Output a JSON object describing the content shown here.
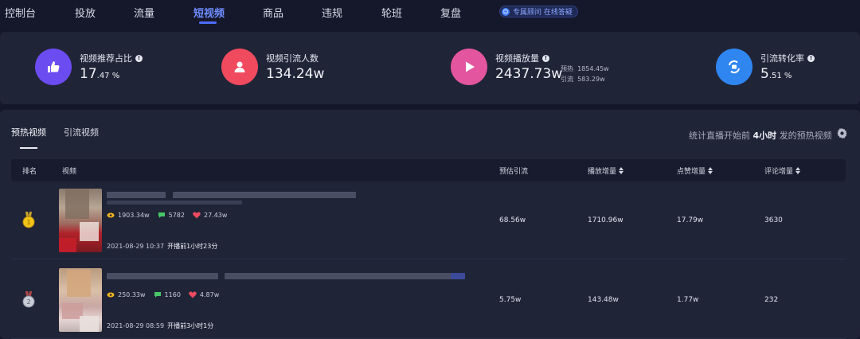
{
  "nav": {
    "items": [
      "控制台",
      "投放",
      "流量",
      "短视频",
      "商品",
      "违规",
      "轮班",
      "复盘"
    ],
    "active_index": 3,
    "consult_label": "专属顾问 在线答疑"
  },
  "stats": [
    {
      "label": "视频推荐占比",
      "value_main": "17",
      "value_small": ".47 %",
      "icon": "thumbs-up-icon",
      "color": "#6b4cf0"
    },
    {
      "label": "视频引流人数",
      "value_main": "134.24w",
      "value_small": "",
      "icon": "user-icon",
      "color": "#f04a5e"
    },
    {
      "label": "视频播放量",
      "value_main": "2437.73w",
      "value_small": "",
      "icon": "play-icon",
      "color": "#e3559f",
      "sub": [
        {
          "label": "预热",
          "value": "1854.45w"
        },
        {
          "label": "引流",
          "value": "583.29w"
        }
      ]
    },
    {
      "label": "引流转化率",
      "value_main": "5",
      "value_small": ".51 %",
      "icon": "convert-icon",
      "color": "#2f86f0"
    }
  ],
  "tabs": [
    "预热视频",
    "引流视频"
  ],
  "note": {
    "prefix": "统计直播开始前",
    "bold": "4小时",
    "suffix": "发的预热视频"
  },
  "table": {
    "headers": [
      "排名",
      "视频",
      "预估引流",
      "播放增量",
      "点赞增量",
      "评论增量"
    ],
    "rows": [
      {
        "rank": "1",
        "plays": "1903.34w",
        "comments": "5782",
        "likes": "27.43w",
        "date": "2021-08-29 10:37",
        "before": "开播前1小时23分",
        "est": "68.56w",
        "play_inc": "1710.96w",
        "like_inc": "17.79w",
        "comment_inc": "3630"
      },
      {
        "rank": "2",
        "plays": "250.33w",
        "comments": "1160",
        "likes": "4.87w",
        "date": "2021-08-29 08:59",
        "before": "开播前3小时1分",
        "est": "5.75w",
        "play_inc": "143.48w",
        "like_inc": "1.77w",
        "comment_inc": "232"
      }
    ]
  }
}
